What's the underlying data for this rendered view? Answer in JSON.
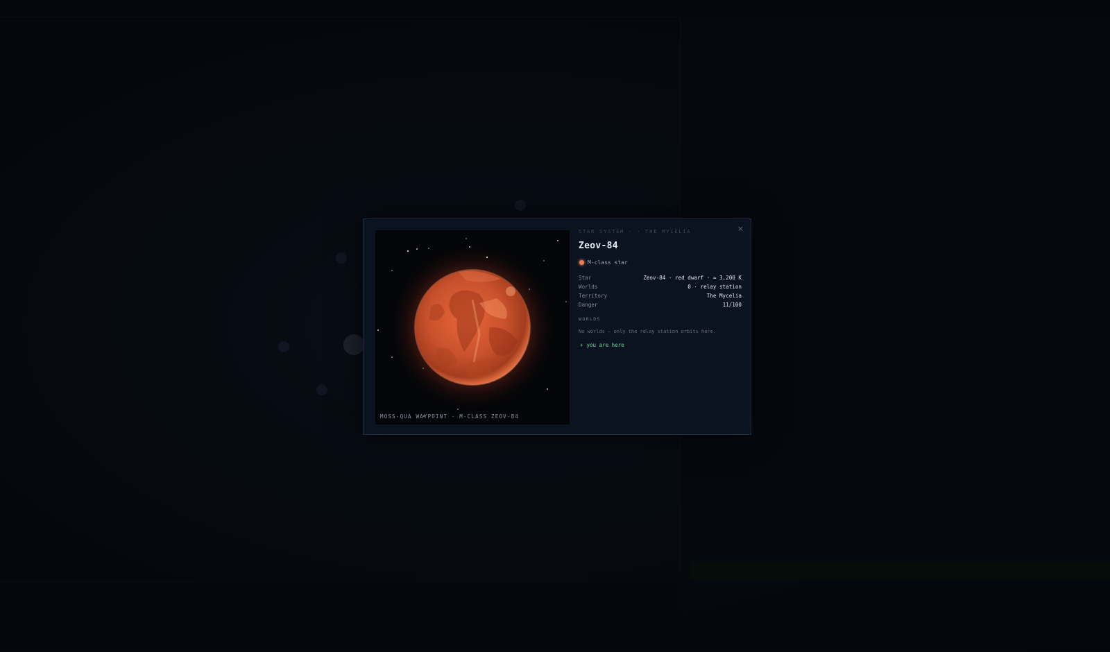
{
  "modal": {
    "kicker": "STAR SYSTEM · · THE MYCELIA",
    "close_glyph": "×",
    "title": "Zeov-84",
    "class_label": "M-class star",
    "class_color": "#ef7a55",
    "stats": [
      {
        "label": "Star",
        "value": "Zeov-84 · red dwarf · ≈ 3,200 K"
      },
      {
        "label": "Worlds",
        "value": "0 · relay station"
      },
      {
        "label": "Territory",
        "value": "The Mycelia"
      },
      {
        "label": "Danger",
        "value": "11/100"
      }
    ],
    "worlds_heading": "WORLDS",
    "worlds_note": "No worlds — only the relay station orbits here.",
    "here_glyph": "+",
    "here_label": "you are here",
    "here_color": "#6bd39b",
    "viewport_caption": "MOSS-QUA WAYPOINT · M-CLASS ZEOV-84",
    "star_color": "#c9522c"
  }
}
